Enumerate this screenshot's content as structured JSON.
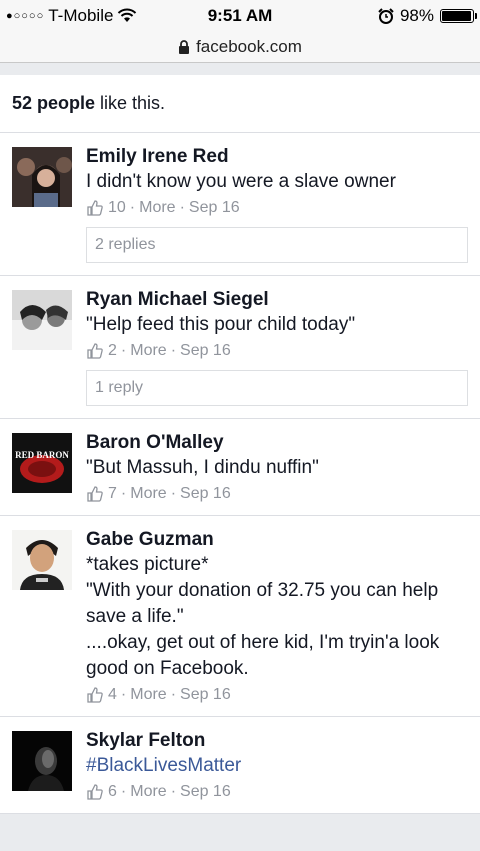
{
  "status_bar": {
    "signal_dots": "●○○○○",
    "carrier": "T-Mobile",
    "wifi_icon": "wifi-icon",
    "time": "9:51 AM",
    "alarm_icon": "alarm-clock-icon",
    "battery": "98%",
    "battery_level": 0.98
  },
  "url_bar": {
    "lock_icon": "lock-icon",
    "url": "facebook.com"
  },
  "likes": {
    "count_text": "52 people",
    "suffix": "like this."
  },
  "comments": [
    {
      "name": "Emily Irene Red",
      "lines": [
        "I didn't know you were a slave owner"
      ],
      "likes": "10",
      "more": "More",
      "date": "Sep 16",
      "replies": "2 replies"
    },
    {
      "name": "Ryan Michael Siegel",
      "lines": [
        "\"Help feed this pour child today\""
      ],
      "likes": "2",
      "more": "More",
      "date": "Sep 16",
      "replies": "1 reply"
    },
    {
      "name": "Baron O'Malley",
      "lines": [
        "\"But Massuh, I dindu nuffin\""
      ],
      "likes": "7",
      "more": "More",
      "date": "Sep 16",
      "avatar_text": "RED BARON"
    },
    {
      "name": "Gabe Guzman",
      "lines": [
        "*takes picture*",
        "\"With your donation of 32.75 you can help save a life.\"",
        "....okay, get out of here kid, I'm tryin'a look good on Facebook."
      ],
      "likes": "4",
      "more": "More",
      "date": "Sep 16"
    },
    {
      "name": "Skylar Felton",
      "lines": [
        "#BlackLivesMatter"
      ],
      "likes": "6",
      "more": "More",
      "date": "Sep 16"
    }
  ],
  "meta_separator": "·",
  "colors": {
    "link": "#3b5998",
    "meta": "#90949c",
    "background": "#e9ebee"
  }
}
